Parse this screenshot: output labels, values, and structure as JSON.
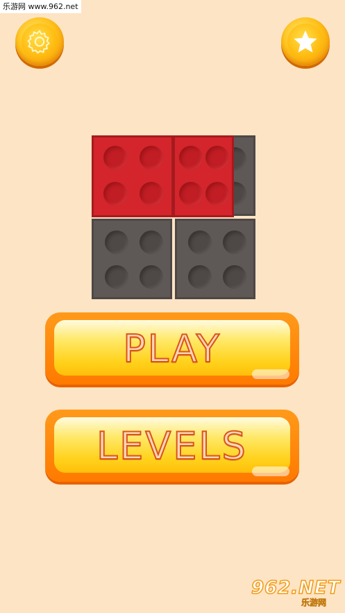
{
  "colors": {
    "background": "#fde4c4",
    "red_tile": "#d3252b",
    "red_dark": "#a51b1f",
    "red_peg": "#c11d24",
    "gray_tile": "#5e5856",
    "gray_peg": "#4e4846",
    "button_orange": "#ff7a00",
    "label_fill": "#ffd6b8"
  },
  "watermark_top": "乐游网 www.962.net",
  "header": {
    "settings_icon": "gear-icon",
    "favorites_icon": "star-icon"
  },
  "board": {
    "grid": "2x2",
    "tiles": [
      {
        "color": "red"
      },
      {
        "color": "red"
      },
      {
        "color": "gray"
      },
      {
        "color": "gray"
      }
    ]
  },
  "menu": {
    "play_label": "PLAY",
    "levels_label": "LEVELS"
  },
  "watermark_bottom": {
    "logo": "962.NET",
    "caption": "乐游网"
  }
}
